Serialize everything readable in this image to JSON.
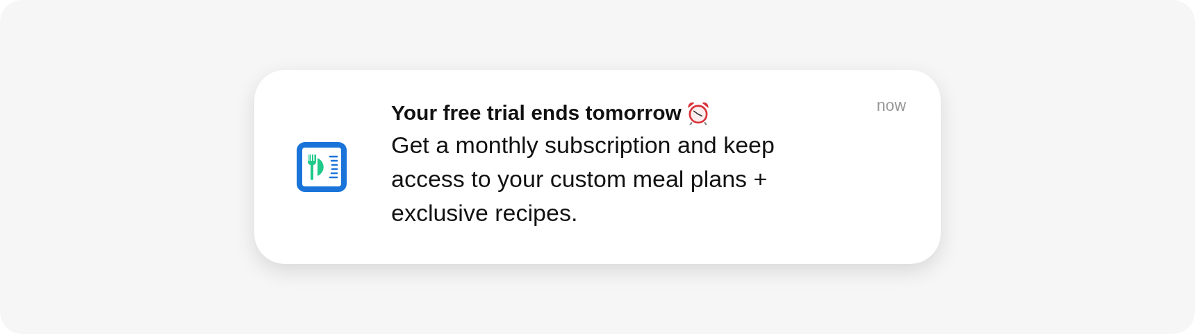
{
  "notification": {
    "title": "Your free trial ends tomorrow",
    "time": "now",
    "body": "Get a monthly subscription and keep access to your custom meal plans + exclusive recipes."
  }
}
